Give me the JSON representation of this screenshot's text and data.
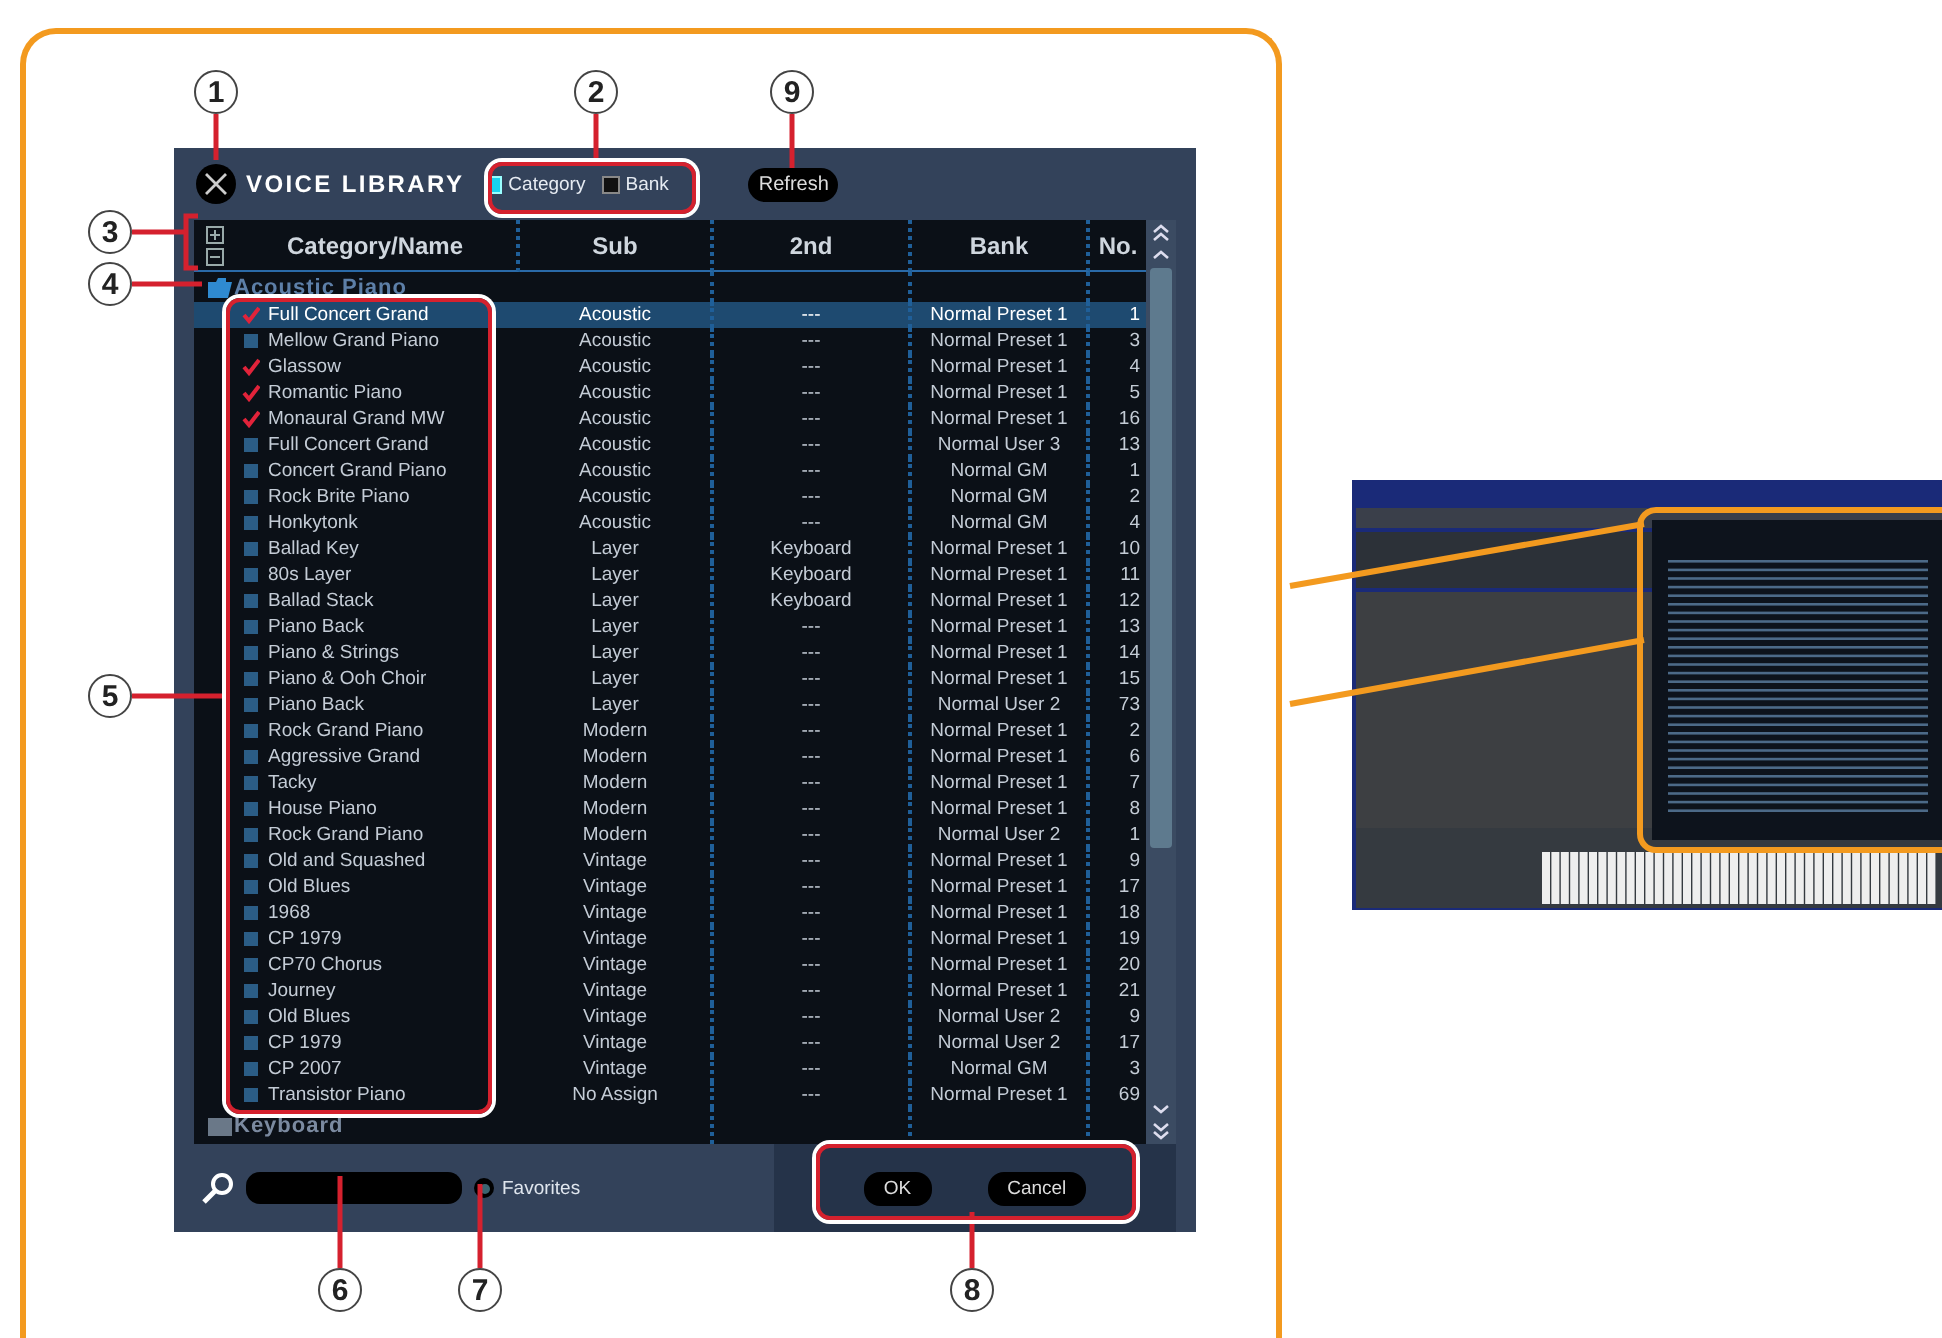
{
  "dialog": {
    "title": "VOICE LIBRARY",
    "view_modes": [
      {
        "label": "Category",
        "selected": true
      },
      {
        "label": "Bank",
        "selected": false
      }
    ],
    "refresh_button": "Refresh",
    "columns": [
      "Category/Name",
      "Sub",
      "2nd",
      "Bank",
      "No."
    ],
    "groups": [
      {
        "name": "Acoustic Piano",
        "expanded": true,
        "rows": [
          {
            "name": "Full Concert Grand",
            "checked": true,
            "selected": true,
            "sub": "Acoustic",
            "second": "---",
            "bank": "Normal Preset 1",
            "no": "1"
          },
          {
            "name": "Mellow Grand Piano",
            "checked": false,
            "selected": false,
            "sub": "Acoustic",
            "second": "---",
            "bank": "Normal Preset 1",
            "no": "3"
          },
          {
            "name": "Glassow",
            "checked": true,
            "selected": false,
            "sub": "Acoustic",
            "second": "---",
            "bank": "Normal Preset 1",
            "no": "4"
          },
          {
            "name": "Romantic Piano",
            "checked": true,
            "selected": false,
            "sub": "Acoustic",
            "second": "---",
            "bank": "Normal Preset 1",
            "no": "5"
          },
          {
            "name": "Monaural Grand MW",
            "checked": true,
            "selected": false,
            "sub": "Acoustic",
            "second": "---",
            "bank": "Normal Preset 1",
            "no": "16"
          },
          {
            "name": "Full Concert Grand",
            "checked": false,
            "selected": false,
            "sub": "Acoustic",
            "second": "---",
            "bank": "Normal User 3",
            "no": "13"
          },
          {
            "name": "Concert Grand Piano",
            "checked": false,
            "selected": false,
            "sub": "Acoustic",
            "second": "---",
            "bank": "Normal GM",
            "no": "1"
          },
          {
            "name": "Rock Brite Piano",
            "checked": false,
            "selected": false,
            "sub": "Acoustic",
            "second": "---",
            "bank": "Normal GM",
            "no": "2"
          },
          {
            "name": "Honkytonk",
            "checked": false,
            "selected": false,
            "sub": "Acoustic",
            "second": "---",
            "bank": "Normal GM",
            "no": "4"
          },
          {
            "name": "Ballad Key",
            "checked": false,
            "selected": false,
            "sub": "Layer",
            "second": "Keyboard",
            "bank": "Normal Preset 1",
            "no": "10"
          },
          {
            "name": "80s Layer",
            "checked": false,
            "selected": false,
            "sub": "Layer",
            "second": "Keyboard",
            "bank": "Normal Preset 1",
            "no": "11"
          },
          {
            "name": "Ballad Stack",
            "checked": false,
            "selected": false,
            "sub": "Layer",
            "second": "Keyboard",
            "bank": "Normal Preset 1",
            "no": "12"
          },
          {
            "name": "Piano Back",
            "checked": false,
            "selected": false,
            "sub": "Layer",
            "second": "---",
            "bank": "Normal Preset 1",
            "no": "13"
          },
          {
            "name": "Piano & Strings",
            "checked": false,
            "selected": false,
            "sub": "Layer",
            "second": "---",
            "bank": "Normal Preset 1",
            "no": "14"
          },
          {
            "name": "Piano & Ooh Choir",
            "checked": false,
            "selected": false,
            "sub": "Layer",
            "second": "---",
            "bank": "Normal Preset 1",
            "no": "15"
          },
          {
            "name": "Piano Back",
            "checked": false,
            "selected": false,
            "sub": "Layer",
            "second": "---",
            "bank": "Normal User 2",
            "no": "73"
          },
          {
            "name": "Rock Grand Piano",
            "checked": false,
            "selected": false,
            "sub": "Modern",
            "second": "---",
            "bank": "Normal Preset 1",
            "no": "2"
          },
          {
            "name": "Aggressive Grand",
            "checked": false,
            "selected": false,
            "sub": "Modern",
            "second": "---",
            "bank": "Normal Preset 1",
            "no": "6"
          },
          {
            "name": "Tacky",
            "checked": false,
            "selected": false,
            "sub": "Modern",
            "second": "---",
            "bank": "Normal Preset 1",
            "no": "7"
          },
          {
            "name": "House Piano",
            "checked": false,
            "selected": false,
            "sub": "Modern",
            "second": "---",
            "bank": "Normal Preset 1",
            "no": "8"
          },
          {
            "name": "Rock Grand Piano",
            "checked": false,
            "selected": false,
            "sub": "Modern",
            "second": "---",
            "bank": "Normal User 2",
            "no": "1"
          },
          {
            "name": "Old and Squashed",
            "checked": false,
            "selected": false,
            "sub": "Vintage",
            "second": "---",
            "bank": "Normal Preset 1",
            "no": "9"
          },
          {
            "name": "Old Blues",
            "checked": false,
            "selected": false,
            "sub": "Vintage",
            "second": "---",
            "bank": "Normal Preset 1",
            "no": "17"
          },
          {
            "name": "1968",
            "checked": false,
            "selected": false,
            "sub": "Vintage",
            "second": "---",
            "bank": "Normal Preset 1",
            "no": "18"
          },
          {
            "name": "CP 1979",
            "checked": false,
            "selected": false,
            "sub": "Vintage",
            "second": "---",
            "bank": "Normal Preset 1",
            "no": "19"
          },
          {
            "name": "CP70 Chorus",
            "checked": false,
            "selected": false,
            "sub": "Vintage",
            "second": "---",
            "bank": "Normal Preset 1",
            "no": "20"
          },
          {
            "name": "Journey",
            "checked": false,
            "selected": false,
            "sub": "Vintage",
            "second": "---",
            "bank": "Normal Preset 1",
            "no": "21"
          },
          {
            "name": "Old Blues",
            "checked": false,
            "selected": false,
            "sub": "Vintage",
            "second": "---",
            "bank": "Normal User 2",
            "no": "9"
          },
          {
            "name": "CP 1979",
            "checked": false,
            "selected": false,
            "sub": "Vintage",
            "second": "---",
            "bank": "Normal User 2",
            "no": "17"
          },
          {
            "name": "CP 2007",
            "checked": false,
            "selected": false,
            "sub": "Vintage",
            "second": "---",
            "bank": "Normal GM",
            "no": "3"
          },
          {
            "name": "Transistor Piano",
            "checked": false,
            "selected": false,
            "sub": "No Assign",
            "second": "---",
            "bank": "Normal Preset 1",
            "no": "69"
          }
        ]
      },
      {
        "name": "Keyboard",
        "expanded": false
      }
    ],
    "favorites": {
      "label": "Favorites",
      "on": false
    },
    "buttons": [
      "OK",
      "Cancel"
    ]
  },
  "callouts": [
    "1",
    "2",
    "9",
    "3",
    "4",
    "5",
    "6",
    "7",
    "8"
  ]
}
